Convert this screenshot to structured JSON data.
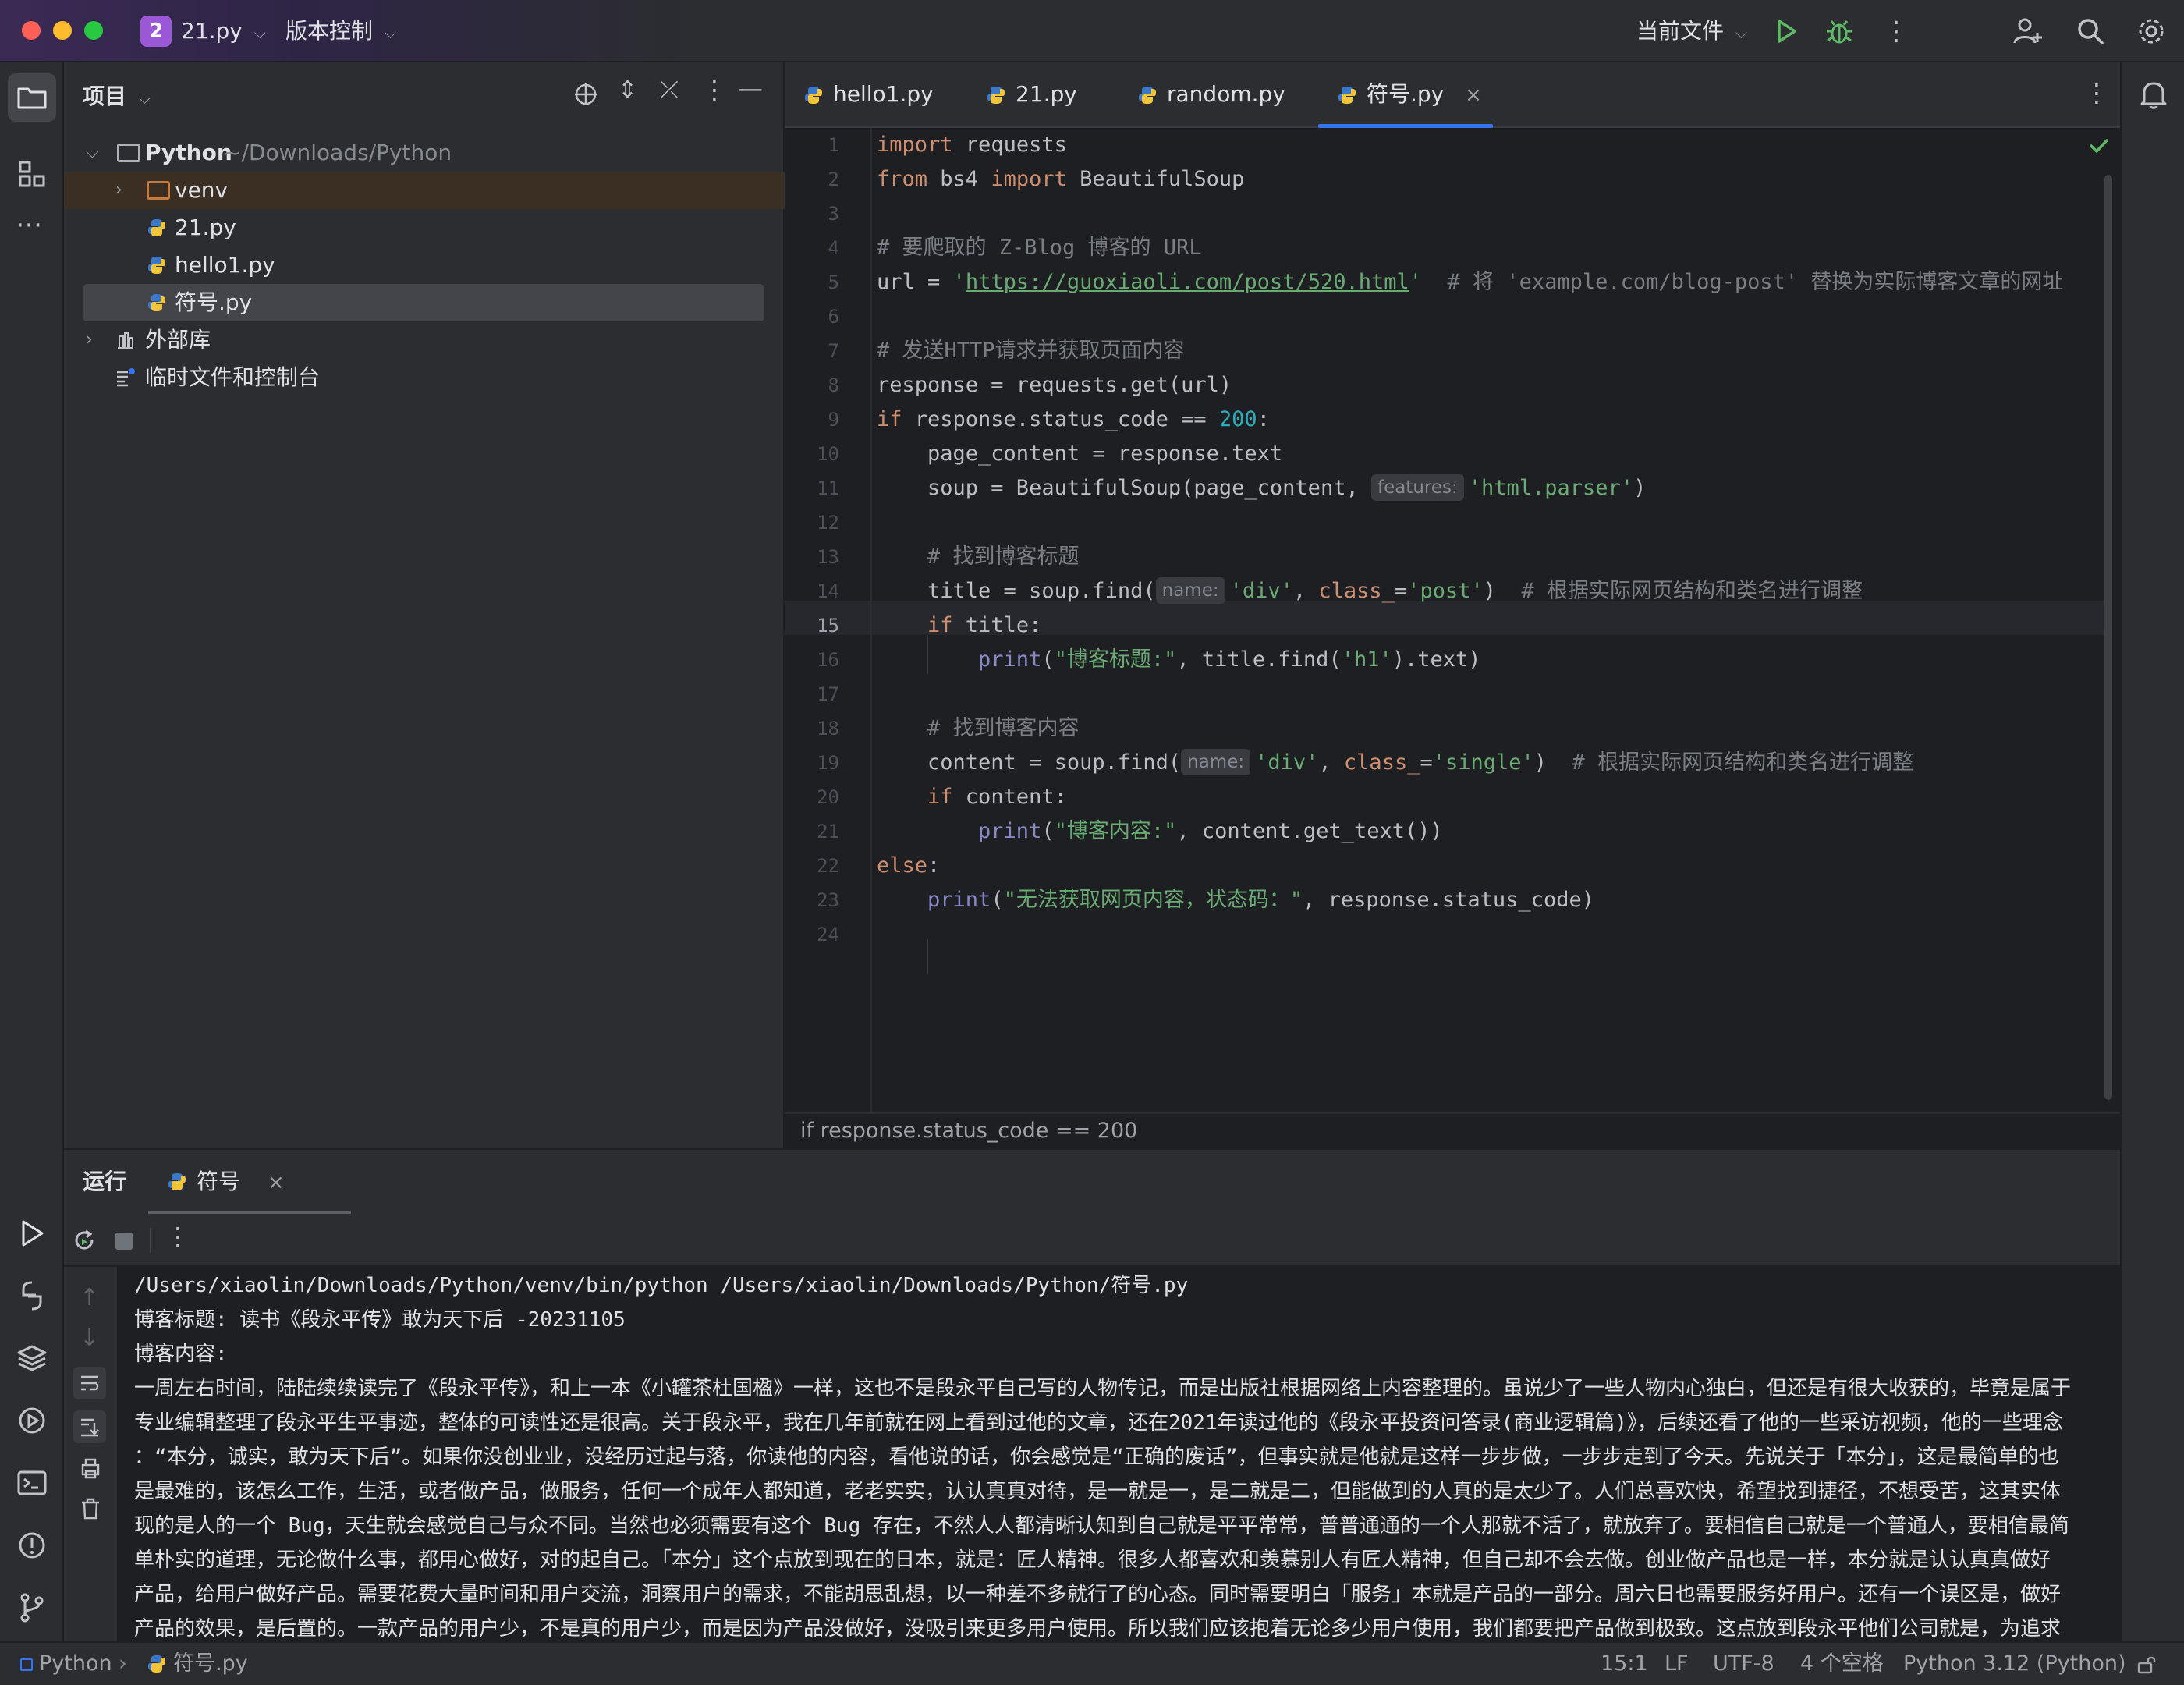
{
  "titlebar": {
    "project_badge": "2",
    "project_name": "21.py",
    "vcs_label": "版本控制",
    "run_config": "当前文件"
  },
  "project_panel": {
    "title": "项目",
    "root_name": "Python",
    "root_path": "~/Downloads/Python",
    "items": [
      {
        "label": "venv"
      },
      {
        "label": "21.py"
      },
      {
        "label": "hello1.py"
      },
      {
        "label": "符号.py"
      },
      {
        "label": "外部库"
      },
      {
        "label": "临时文件和控制台"
      }
    ]
  },
  "tabs": [
    {
      "label": "hello1.py"
    },
    {
      "label": "21.py"
    },
    {
      "label": "random.py"
    },
    {
      "label": "符号.py"
    }
  ],
  "editor": {
    "line_numbers": [
      "1",
      "2",
      "3",
      "4",
      "5",
      "6",
      "7",
      "8",
      "9",
      "10",
      "11",
      "12",
      "13",
      "14",
      "15",
      "16",
      "17",
      "18",
      "19",
      "20",
      "21",
      "22",
      "23",
      "24"
    ],
    "code": {
      "l1_kw": "import",
      "l1_rest": " requests",
      "l2_kw1": "from",
      "l2_mid": " bs4 ",
      "l2_kw2": "import",
      "l2_rest": " BeautifulSoup",
      "l4_cmt": "# 要爬取的 Z-Blog 博客的 URL",
      "l5_pre": "url = ",
      "l5_q": "'",
      "l5_url": "https://guoxiaoli.com/post/520.html",
      "l5_q2": "'",
      "l5_cmt": "  # 将 'example.com/blog-post' 替换为实际博客文章的网址",
      "l7_cmt": "# 发送HTTP请求并获取页面内容",
      "l8": "response = requests.get(url)",
      "l9_kw": "if",
      "l9_mid": " response.status_code == ",
      "l9_num": "200",
      "l9_end": ":",
      "l10": "    page_content = response.text",
      "l11_pre": "    soup = BeautifulSoup(page_content, ",
      "l11_hint": "features:",
      "l11_str": "'html.parser'",
      "l11_end": ")",
      "l13_cmt": "    # 找到博客标题",
      "l14_pre": "    title = soup.find(",
      "l14_hint": "name:",
      "l14_str1": "'div'",
      "l14_sep": ", ",
      "l14_param": "class_",
      "l14_eq": "=",
      "l14_str2": "'post'",
      "l14_end": ")",
      "l14_cmt": "  # 根据实际网页结构和类名进行调整",
      "l15_kw": "    if",
      "l15_rest": " title:",
      "l16_bi": "        print",
      "l16_p": "(",
      "l16_str": "\"博客标题:\"",
      "l16_mid": ", title.find(",
      "l16_str2": "'h1'",
      "l16_end": ").text)",
      "l18_cmt": "    # 找到博客内容",
      "l19_pre": "    content = soup.find(",
      "l19_hint": "name:",
      "l19_str1": "'div'",
      "l19_sep": ", ",
      "l19_param": "class_",
      "l19_eq": "=",
      "l19_str2": "'single'",
      "l19_end": ")",
      "l19_cmt": "  # 根据实际网页结构和类名进行调整",
      "l20_kw": "    if",
      "l20_rest": " content:",
      "l21_bi": "        print",
      "l21_p": "(",
      "l21_str": "\"博客内容:\"",
      "l21_end": ", content.get_text())",
      "l22_kw": "else",
      "l22_end": ":",
      "l23_bi": "    print",
      "l23_p": "(",
      "l23_str": "\"无法获取网页内容，状态码：\"",
      "l23_end": ", response.status_code)"
    },
    "breadcrumb": "if response.status_code == 200"
  },
  "run_panel": {
    "title": "运行",
    "tab_label": "符号",
    "console_lines": [
      "/Users/xiaolin/Downloads/Python/venv/bin/python /Users/xiaolin/Downloads/Python/符号.py",
      "博客标题: 读书《段永平传》敢为天下后 -20231105",
      "博客内容:",
      "一周左右时间，陆陆续续读完了《段永平传》，和上一本《小罐茶杜国楹》一样，这也不是段永平自己写的人物传记，而是出版社根据网络上内容整理的。虽说少了一些人物内心独白，但还是有很大收获的，毕竟是属于",
      " 专业编辑整理了段永平生平事迹，整体的可读性还是很高。关于段永平，我在几年前就在网上看到过他的文章，还在2021年读过他的《段永平投资问答录(商业逻辑篇)》，后续还看了他的一些采访视频，他的一些理念",
      " ：“本分，诚实，敢为天下后”。如果你没创业业，没经历过起与落，你读他的内容，看他说的话，你会感觉是“正确的废话”，但事实就是他就是这样一步步做，一步步走到了今天。先说关于「本分」，这是最简单的也",
      " 是最难的，该怎么工作，生活，或者做产品，做服务，任何一个成年人都知道，老老实实，认认真真对待，是一就是一，是二就是二，但能做到的人真的是太少了。人们总喜欢快，希望找到捷径，不想受苦，这其实体",
      " 现的是人的一个 Bug，天生就会感觉自己与众不同。当然也必须需要有这个 Bug 存在，不然人人都清晰认知到自己就是平平常常，普普通通的一个人那就不活了，就放弃了。要相信自己就是一个普通人，要相信最简",
      " 单朴实的道理，无论做什么事，都用心做好，对的起自己。「本分」这个点放到现在的日本，就是：匠人精神。很多人都喜欢和羡慕别人有匠人精神，但自己却不会去做。创业做产品也是一样，本分就是认认真真做好",
      " 产品，给用户做好产品。需要花费大量时间和用户交流，洞察用户的需求，不能胡思乱想，以一种差不多就行了的心态。同时需要明白「服务」本就是产品的一部分。周六日也需要服务好用户。还有一个误区是，做好",
      " 产品的效果，是后置的。一款产品的用户少，不是真的用户少，而是因为产品没做好，没吸引来更多用户使用。所以我们应该抱着无论多少用户使用，我们都要把产品做到极致。这点放到段永平他们公司就是，为追求"
    ]
  },
  "statusbar": {
    "project": "Python",
    "file": "符号.py",
    "position": "15:1",
    "line_sep": "LF",
    "encoding": "UTF-8",
    "indent": "4 个空格",
    "interpreter": "Python 3.12 (Python)"
  },
  "colors": {
    "accent": "#3574f0",
    "run_green": "#5fb865",
    "badge_purple": "#9a58d6"
  }
}
